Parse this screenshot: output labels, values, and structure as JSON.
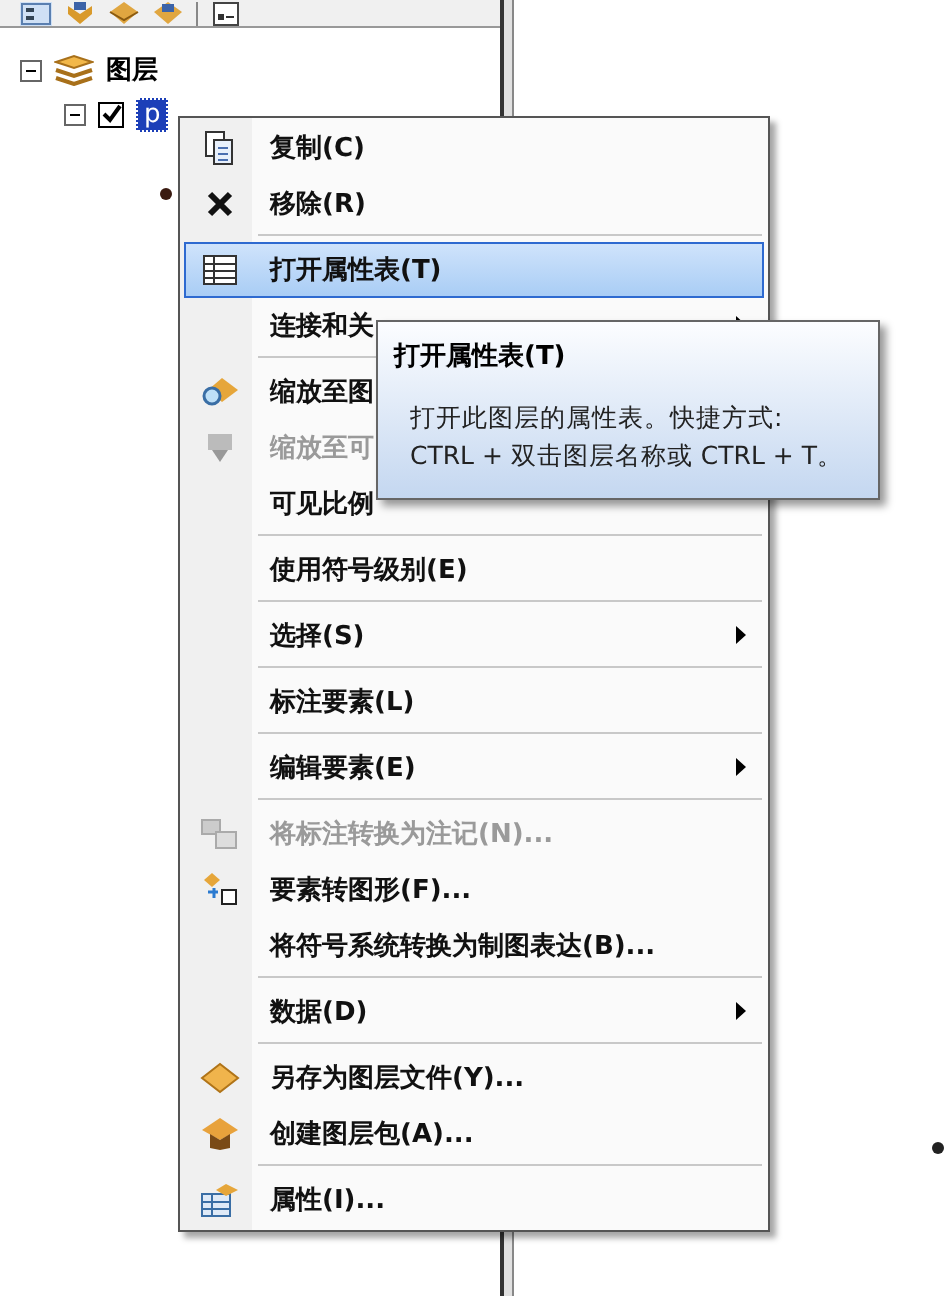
{
  "tree": {
    "label": "图层",
    "expanded": true,
    "children": [
      {
        "label": "p",
        "checked": true,
        "selected": true,
        "expanded": true
      }
    ]
  },
  "menu": {
    "items": [
      {
        "label": "复制(C)",
        "disabled": false,
        "selected": false,
        "submenu": false,
        "separator_after": false
      },
      {
        "label": "移除(R)",
        "disabled": false,
        "selected": false,
        "submenu": false,
        "separator_after": true
      },
      {
        "label": "打开属性表(T)",
        "disabled": false,
        "selected": true,
        "submenu": false,
        "separator_after": false
      },
      {
        "label": "连接和关",
        "disabled": false,
        "selected": false,
        "submenu": true,
        "separator_after": true
      },
      {
        "label": "缩放至图",
        "disabled": false,
        "selected": false,
        "separator_after": false
      },
      {
        "label": "缩放至可",
        "disabled": true,
        "selected": false,
        "separator_after": false
      },
      {
        "label": "可见比例",
        "disabled": false,
        "selected": false,
        "separator_after": true
      },
      {
        "label": "使用符号级别(E)",
        "disabled": false,
        "selected": false,
        "submenu": false,
        "separator_after": true
      },
      {
        "label": "选择(S)",
        "disabled": false,
        "selected": false,
        "submenu": true,
        "separator_after": true
      },
      {
        "label": "标注要素(L)",
        "disabled": false,
        "selected": false,
        "submenu": false,
        "separator_after": true
      },
      {
        "label": "编辑要素(E)",
        "disabled": false,
        "selected": false,
        "submenu": true,
        "separator_after": true
      },
      {
        "label": "将标注转换为注记(N)...",
        "disabled": true,
        "selected": false,
        "submenu": false,
        "separator_after": false
      },
      {
        "label": "要素转图形(F)...",
        "disabled": false,
        "selected": false,
        "submenu": false,
        "separator_after": false
      },
      {
        "label": "将符号系统转换为制图表达(B)...",
        "disabled": false,
        "selected": false,
        "submenu": false,
        "separator_after": true
      },
      {
        "label": "数据(D)",
        "disabled": false,
        "selected": false,
        "submenu": true,
        "separator_after": true
      },
      {
        "label": "另存为图层文件(Y)...",
        "disabled": false,
        "selected": false,
        "submenu": false,
        "separator_after": false
      },
      {
        "label": "创建图层包(A)...",
        "disabled": false,
        "selected": false,
        "submenu": false,
        "separator_after": true
      },
      {
        "label": "属性(I)...",
        "disabled": false,
        "selected": false,
        "submenu": false,
        "separator_after": false
      }
    ]
  },
  "tooltip": {
    "title": "打开属性表(T)",
    "text": "打开此图层的属性表。快捷方式: CTRL + 双击图层名称或 CTRL + T。"
  }
}
